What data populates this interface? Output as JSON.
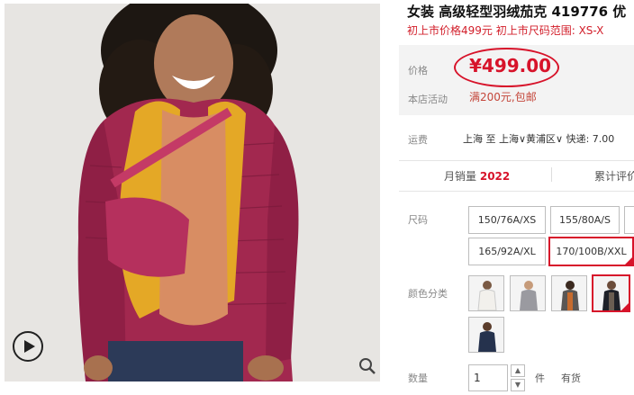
{
  "product": {
    "title": "女装 高级轻型羽绒茄克 419776 优",
    "subtitle": "初上市价格499元 初上市尺码范围: XS-X"
  },
  "price": {
    "label": "价格",
    "value": "¥499.00"
  },
  "promotion": {
    "label": "本店活动",
    "text": "满200元,包邮"
  },
  "shipping": {
    "label": "运费",
    "text": "上海 至 上海∨黄浦区∨ 快递: 7.00"
  },
  "stats": {
    "sales_label": "月销量",
    "sales_value": "2022",
    "reviews_label": "累计评价"
  },
  "size": {
    "label": "尺码",
    "options": [
      "150/76A/XS",
      "155/80A/S",
      "165/92A/XL",
      "170/100B/XXL"
    ],
    "selected": "170/100B/XXL"
  },
  "color": {
    "label": "颜色分类",
    "swatches": [
      "white-jacket",
      "grey-jacket",
      "dark-grey-jacket",
      "black-jacket",
      "navy-jacket"
    ],
    "selected": "black-jacket",
    "colors": {
      "white-jacket": "#f2f0ec",
      "grey-jacket": "#9a9aa0",
      "dark-grey-jacket": "#5a5755",
      "black-jacket": "#1e2128",
      "navy-jacket": "#25324d"
    }
  },
  "quantity": {
    "label": "数量",
    "value": "1",
    "unit": "件",
    "stock": "有货"
  },
  "accent_color": "#d7132a",
  "icons": {
    "play": "play-icon",
    "zoom": "zoom-icon"
  }
}
